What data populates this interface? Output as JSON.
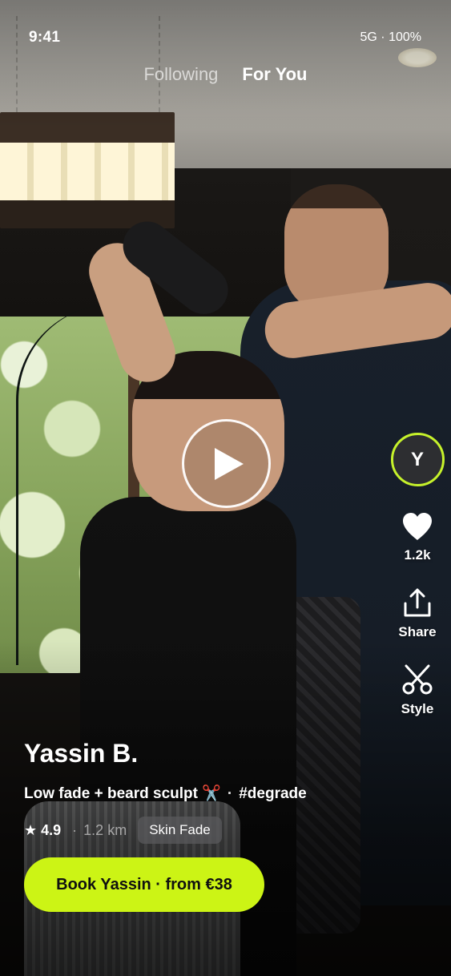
{
  "status_bar": {
    "time": "9:41",
    "network": "5G · 100%"
  },
  "feed_tabs": [
    {
      "label": "Following",
      "active": false
    },
    {
      "label": "For You",
      "active": true
    }
  ],
  "video": {
    "play_icon": "play-icon"
  },
  "rail": {
    "avatar_initial": "Y",
    "like_count": "1.2k",
    "share_label": "Share",
    "style_label": "Style"
  },
  "post": {
    "barber_name": "Yassin B.",
    "caption_text": "Low fade + beard sculpt ✂️",
    "caption_separator": "·",
    "hashtag": "#degrade",
    "rating": "★ 4.9",
    "meta_separator": "·",
    "distance": "1.2 km",
    "style_tag": "Skin Fade"
  },
  "cta": {
    "book_label": "Book Yassin · from €38"
  },
  "colors": {
    "accent": "#ccf415",
    "avatar_ring": "#c6f22b"
  }
}
